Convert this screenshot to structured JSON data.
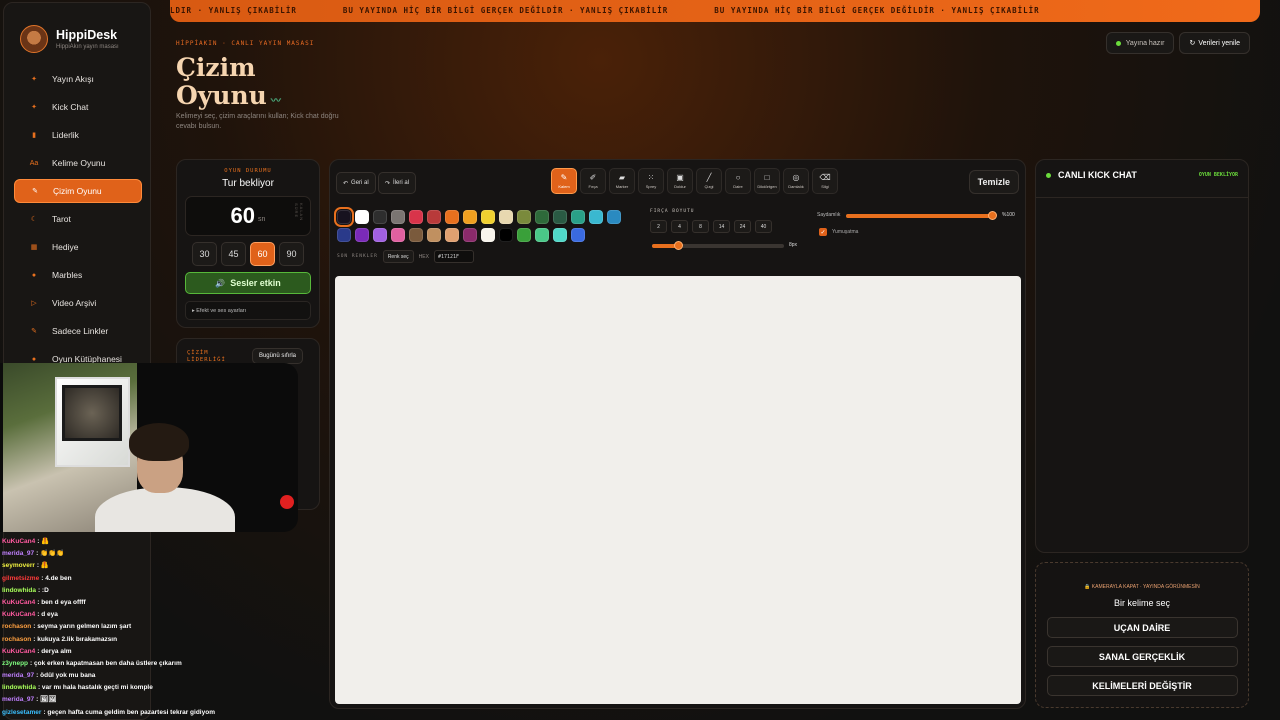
{
  "banner": {
    "ticker": [
      "LDIR · YANLIŞ ÇIKABİLİR",
      "BU YAYINDA HİÇ BİR BİLGİ GERÇEK DEĞİLDİR · YANLIŞ ÇIKABİLİR",
      "BU YAYINDA HİÇ BİR BİLGİ GERÇEK DEĞİLDİR · YANLIŞ ÇIKABİLİR"
    ]
  },
  "brand": {
    "name": "HippiDesk",
    "subtitle": "HippiAkın yayın masası"
  },
  "sidebar": {
    "items": [
      {
        "label": "Yayın Akışı",
        "icon": "plus-icon",
        "glyph": "✦"
      },
      {
        "label": "Kick Chat",
        "icon": "plus-icon",
        "glyph": "✦"
      },
      {
        "label": "Liderlik",
        "icon": "trophy-icon",
        "glyph": "▮"
      },
      {
        "label": "Kelime Oyunu",
        "icon": "text-icon",
        "glyph": "Aa"
      },
      {
        "label": "Çizim Oyunu",
        "icon": "brush-icon",
        "glyph": "✎",
        "active": true
      },
      {
        "label": "Tarot",
        "icon": "moon-icon",
        "glyph": "☾"
      },
      {
        "label": "Hediye",
        "icon": "gift-icon",
        "glyph": "▦"
      },
      {
        "label": "Marbles",
        "icon": "dot-icon",
        "glyph": "●"
      },
      {
        "label": "Video Arşivi",
        "icon": "play-icon",
        "glyph": "▷"
      },
      {
        "label": "Sadece Linkler",
        "icon": "link-icon",
        "glyph": "✎"
      },
      {
        "label": "Oyun Kütüphanesi",
        "icon": "gamepad-icon",
        "glyph": "●"
      }
    ]
  },
  "header": {
    "kicker": "HİPPİAKIN · CANLI YAYIN MASASI",
    "title_line1": "Çizim",
    "title_line2": "Oyunu",
    "description": "Kelimeyi seç, çizim araçlarını kullan; Kick chat doğru cevabı bulsun.",
    "status_pill": "Yayına hazır",
    "refresh_button": "Verileri yenile"
  },
  "game_status": {
    "label": "OYUN DURUMU",
    "title": "Tur bekliyor",
    "time": "60",
    "unit": "sn",
    "side_label": "KALAN SÜRE",
    "options": [
      "30",
      "45",
      "60",
      "90"
    ],
    "selected": "60",
    "sound_button": "Sesler etkin",
    "effects_toggle": "▸ Efekt ve ses ayarları"
  },
  "leaderboard": {
    "title": "ÇİZİM LİDERLİĞİ",
    "reset_button": "Bugünü sıfırla"
  },
  "toolbar": {
    "undo": "Geri al",
    "redo": "İleri al",
    "clear": "Temizle",
    "tools": [
      {
        "label": "Kalem",
        "icon": "pen-icon",
        "glyph": "✎",
        "active": true
      },
      {
        "label": "Fırça",
        "icon": "brush-icon",
        "glyph": "✐"
      },
      {
        "label": "Marker",
        "icon": "marker-icon",
        "glyph": "▰"
      },
      {
        "label": "Sprey",
        "icon": "spray-icon",
        "glyph": "⁙"
      },
      {
        "label": "Doldur",
        "icon": "bucket-icon",
        "glyph": "▣"
      },
      {
        "label": "Çizgi",
        "icon": "line-icon",
        "glyph": "╱"
      },
      {
        "label": "Daire",
        "icon": "circle-icon",
        "glyph": "○"
      },
      {
        "label": "Dikdörtgen",
        "icon": "rectangle-icon",
        "glyph": "□"
      },
      {
        "label": "Damlalık",
        "icon": "eyedropper-icon",
        "glyph": "◎"
      },
      {
        "label": "Silgi",
        "icon": "eraser-icon",
        "glyph": "⌫"
      }
    ]
  },
  "palette": {
    "colors": [
      "#17121f",
      "#ffffff",
      "#2e2e2e",
      "#7a7572",
      "#d8344a",
      "#b83a3a",
      "#e8701e",
      "#f0a020",
      "#f0d030",
      "#e8d8b0",
      "#7a8a3c",
      "#2e6a3a",
      "#2a5a44",
      "#2aa088",
      "#3ab8d0",
      "#2a8ac0",
      "#2a3a8a",
      "#7a2ab8",
      "#a060e0",
      "#e060a0",
      "#7a5a3c",
      "#c09060",
      "#e0a070",
      "#8a2a6a",
      "#f8f4ec",
      "#000000",
      "#3aa03a",
      "#4ac888",
      "#50d8c8",
      "#3a6ae0"
    ],
    "selected": "#17121f",
    "recent_label": "SON RENKLER",
    "pick_button": "Renk seç",
    "hex_label": "HEX",
    "hex_value": "#17121F"
  },
  "brush": {
    "label": "FIRÇA BOYUTU",
    "sizes": [
      "2",
      "4",
      "8",
      "14",
      "24",
      "40"
    ],
    "value": 8,
    "max": 40,
    "value_label": "8px"
  },
  "opacity": {
    "label": "Saydamlık",
    "value": 100,
    "value_label": "%100",
    "smoothing_label": "Yumuşatma",
    "smoothing": true
  },
  "chat": {
    "title": "CANLI KICK CHAT",
    "status": "OYUN BEKLİYOR"
  },
  "word_picker": {
    "warning": "🔒 KAMERAYLA KAPAT · YAYINDA GÖRÜNMESİN",
    "title": "Bir kelime seç",
    "options": [
      "UÇAN DAİRE",
      "SANAL GERÇEKLİK",
      "KELİMELERİ DEĞİŞTİR"
    ]
  },
  "chat_overlay": [
    {
      "user": "KuKuCan4",
      "color": "#ff5aa0",
      "message": ": 🦺"
    },
    {
      "user": "merida_97",
      "color": "#c080ff",
      "message": ": 👏👏👏"
    },
    {
      "user": "seymoverr",
      "color": "#f0f040",
      "message": ": 🦺"
    },
    {
      "user": "gilmetsizme",
      "color": "#ff3a3a",
      "message": ": 4.de ben"
    },
    {
      "user": "lindowhida",
      "color": "#a8ff5a",
      "message": ": :D"
    },
    {
      "user": "KuKuCan4",
      "color": "#ff5aa0",
      "message": ": ben d eya offff"
    },
    {
      "user": "KuKuCan4",
      "color": "#ff5aa0",
      "message": ": d eya"
    },
    {
      "user": "rochason",
      "color": "#ffa040",
      "message": ": seyma yarın gelmen lazım şart"
    },
    {
      "user": "rochason",
      "color": "#ffa040",
      "message": ": kukuya 2.lik bırakamazsın"
    },
    {
      "user": "KuKuCan4",
      "color": "#ff5aa0",
      "message": ": derya alm"
    },
    {
      "user": "z3ynepp",
      "color": "#80ff80",
      "message": ": çok erken kapatmasan ben daha üstlere çıkarım"
    },
    {
      "user": "merida_97",
      "color": "#c080ff",
      "message": ": ödül yok mu bana"
    },
    {
      "user": "lindowhida",
      "color": "#a8ff5a",
      "message": ": var mı hala hastalık geçti mi komple"
    },
    {
      "user": "merida_97",
      "color": "#c080ff",
      "message": ": 🖼🖼"
    },
    {
      "user": "gizlesetamer",
      "color": "#3ac0ff",
      "message": ": geçen hafta cuma geldim ben pazartesi tekrar gidiyom"
    }
  ]
}
